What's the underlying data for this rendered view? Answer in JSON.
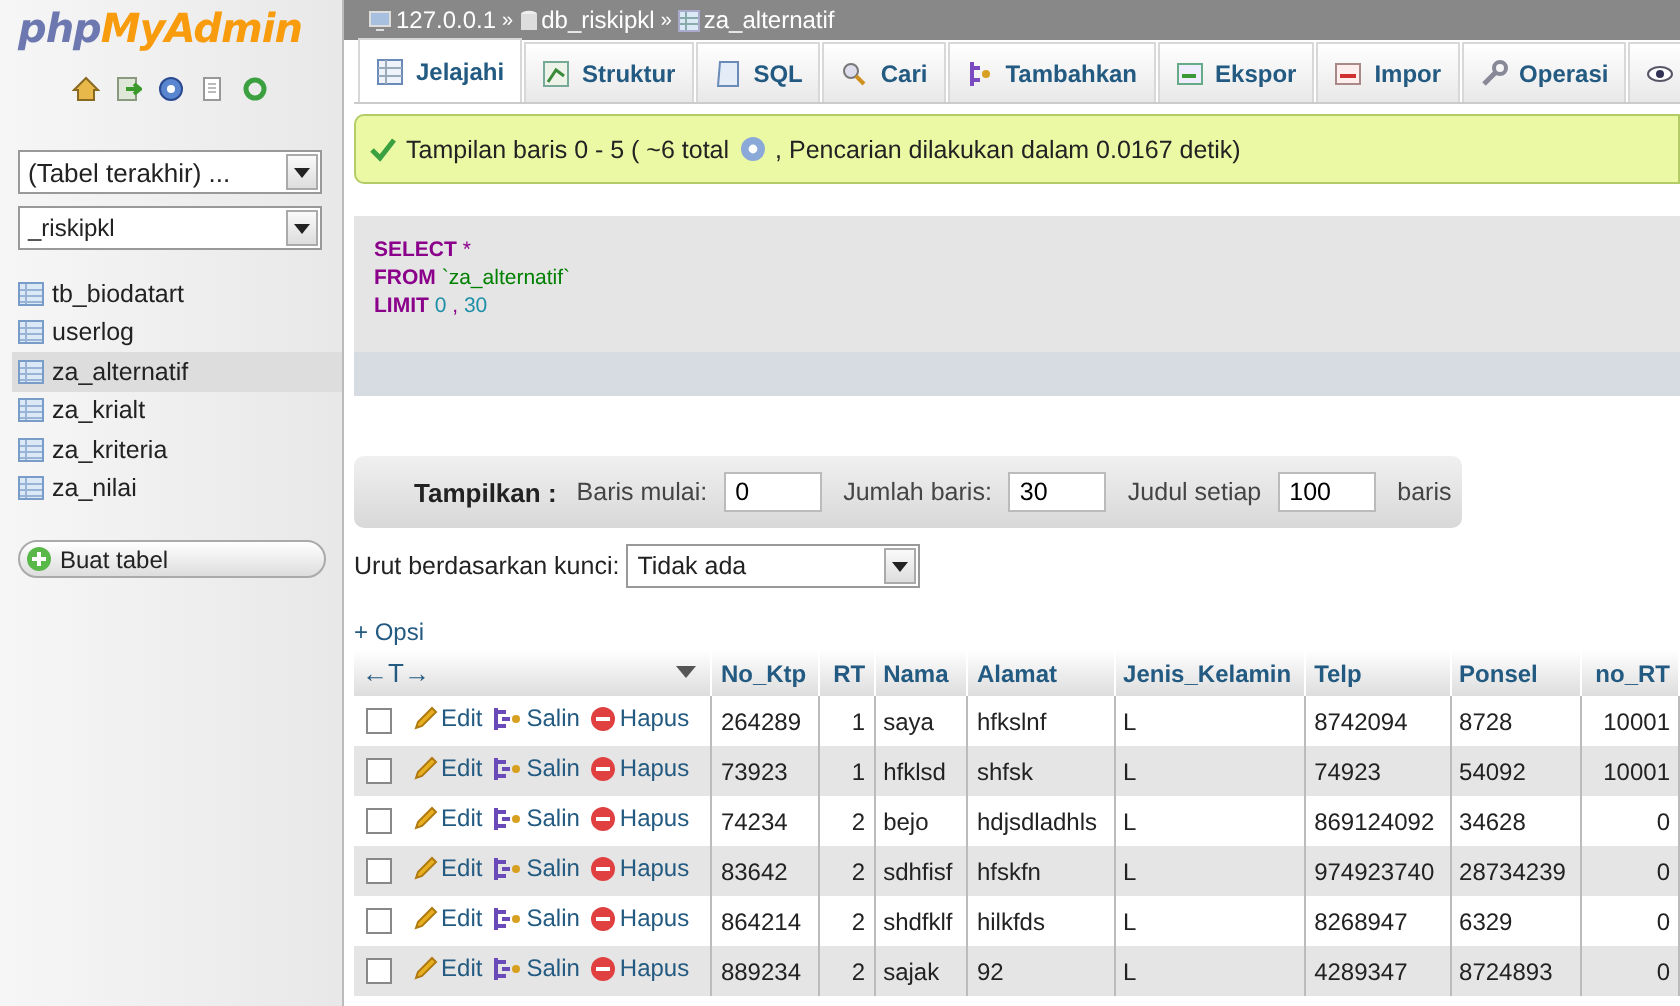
{
  "logo": {
    "part1": "php",
    "part2": "MyAdmin"
  },
  "sidebar": {
    "recent_select": "(Tabel terakhir) ...",
    "database_select": "_riskipkl",
    "tables": [
      {
        "name": "tb_biodatart",
        "selected": false
      },
      {
        "name": "userlog",
        "selected": false
      },
      {
        "name": "za_alternatif",
        "selected": true
      },
      {
        "name": "za_krialt",
        "selected": false
      },
      {
        "name": "za_kriteria",
        "selected": false
      },
      {
        "name": "za_nilai",
        "selected": false
      }
    ],
    "create_button": "Buat tabel"
  },
  "breadcrumb": {
    "separator": "»",
    "items": [
      {
        "kind": "server",
        "label": "127.0.0.1"
      },
      {
        "kind": "database",
        "label": "db_riskipkl"
      },
      {
        "kind": "table",
        "label": "za_alternatif"
      }
    ]
  },
  "tabs": [
    {
      "kind": "browse",
      "label": "Jelajahi",
      "selected": true
    },
    {
      "kind": "structure",
      "label": "Struktur",
      "selected": false
    },
    {
      "kind": "sql",
      "label": "SQL",
      "selected": false
    },
    {
      "kind": "search",
      "label": "Cari",
      "selected": false
    },
    {
      "kind": "insert",
      "label": "Tambahkan",
      "selected": false
    },
    {
      "kind": "export",
      "label": "Ekspor",
      "selected": false
    },
    {
      "kind": "import",
      "label": "Impor",
      "selected": false
    },
    {
      "kind": "operations",
      "label": "Operasi",
      "selected": false
    },
    {
      "kind": "tracking",
      "selected": false
    }
  ],
  "message": {
    "before_icon": "Tampilan baris 0 - 5 ( ~6 total",
    "after_icon": ", Pencarian dilakukan dalam 0.0167 detik)"
  },
  "sql": [
    [
      {
        "kind": "keyword",
        "text": "SELECT"
      },
      {
        "kind": "operator",
        "text": "*"
      }
    ],
    [
      {
        "kind": "keyword",
        "text": "FROM"
      },
      {
        "kind": "string",
        "text": "`za_alternatif`"
      }
    ],
    [
      {
        "kind": "keyword",
        "text": "LIMIT"
      },
      {
        "kind": "number",
        "text": "0"
      },
      {
        "kind": "operator",
        "text": ","
      },
      {
        "kind": "number",
        "text": "30"
      }
    ]
  ],
  "navigation": {
    "label": "Tampilkan :",
    "fields": [
      {
        "label": "Baris mulai:",
        "value": "0"
      },
      {
        "label": "Jumlah baris:",
        "value": "30"
      },
      {
        "label": "Judul setiap",
        "value": "100"
      }
    ],
    "suffix": "baris"
  },
  "sort": {
    "label": "Urut berdasarkan kunci:",
    "value": "Tidak ada"
  },
  "options_link": "+ Opsi",
  "table": {
    "arrows": "←T→",
    "columns": [
      {
        "label": "No_Ktp",
        "kind": "text"
      },
      {
        "label": "RT",
        "kind": "number"
      },
      {
        "label": "Nama",
        "kind": "text"
      },
      {
        "label": "Alamat",
        "kind": "text"
      },
      {
        "label": "Jenis_Kelamin",
        "kind": "text"
      },
      {
        "label": "Telp",
        "kind": "text"
      },
      {
        "label": "Ponsel",
        "kind": "text"
      },
      {
        "label": "no_RT",
        "kind": "number"
      }
    ],
    "rows": [
      {
        "checked": false,
        "actions": [
          {
            "kind": "edit",
            "label": "Edit"
          },
          {
            "kind": "copy",
            "label": "Salin"
          },
          {
            "kind": "delete",
            "label": "Hapus"
          }
        ],
        "cells": [
          "264289",
          "1",
          "saya",
          "hfkslnf",
          "L",
          "8742094",
          "8728",
          "10001"
        ]
      },
      {
        "checked": false,
        "actions": [
          {
            "kind": "edit",
            "label": "Edit"
          },
          {
            "kind": "copy",
            "label": "Salin"
          },
          {
            "kind": "delete",
            "label": "Hapus"
          }
        ],
        "cells": [
          "73923",
          "1",
          "hfklsd",
          "shfsk",
          "L",
          "74923",
          "54092",
          "10001"
        ]
      },
      {
        "checked": false,
        "actions": [
          {
            "kind": "edit",
            "label": "Edit"
          },
          {
            "kind": "copy",
            "label": "Salin"
          },
          {
            "kind": "delete",
            "label": "Hapus"
          }
        ],
        "cells": [
          "74234",
          "2",
          "bejo",
          "hdjsdladhls",
          "L",
          "869124092",
          "34628",
          "0"
        ]
      },
      {
        "checked": false,
        "actions": [
          {
            "kind": "edit",
            "label": "Edit"
          },
          {
            "kind": "copy",
            "label": "Salin"
          },
          {
            "kind": "delete",
            "label": "Hapus"
          }
        ],
        "cells": [
          "83642",
          "2",
          "sdhfisf",
          "hfskfn",
          "L",
          "974923740",
          "28734239",
          "0"
        ]
      },
      {
        "checked": false,
        "actions": [
          {
            "kind": "edit",
            "label": "Edit"
          },
          {
            "kind": "copy",
            "label": "Salin"
          },
          {
            "kind": "delete",
            "label": "Hapus"
          }
        ],
        "cells": [
          "864214",
          "2",
          "shdfklf",
          "hilkfds",
          "L",
          "8268947",
          "6329",
          "0"
        ]
      },
      {
        "checked": false,
        "actions": [
          {
            "kind": "edit",
            "label": "Edit"
          },
          {
            "kind": "copy",
            "label": "Salin"
          },
          {
            "kind": "delete",
            "label": "Hapus"
          }
        ],
        "cells": [
          "889234",
          "2",
          "sajak",
          "92",
          "L",
          "4289347",
          "8724893",
          "0"
        ]
      }
    ]
  }
}
